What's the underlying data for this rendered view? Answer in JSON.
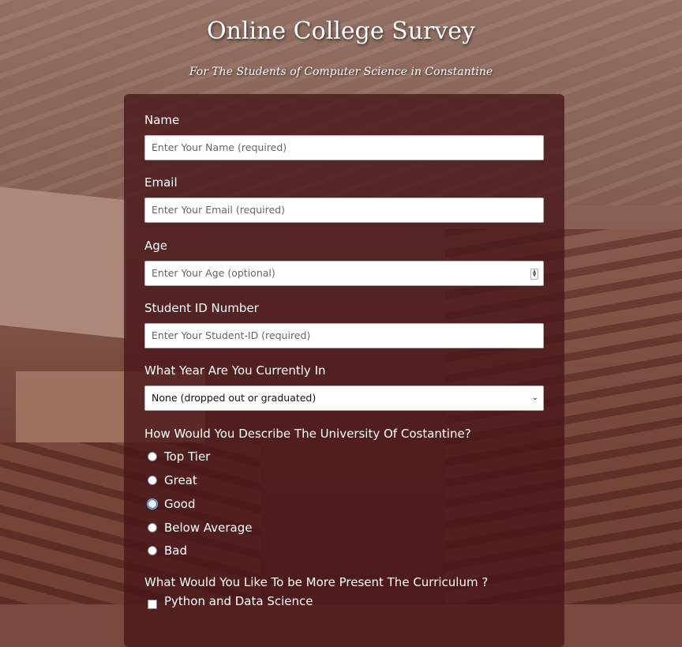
{
  "header": {
    "title": "Online College Survey",
    "subtitle": "For The Students of Computer Science in Constantine"
  },
  "form": {
    "name": {
      "label": "Name",
      "placeholder": "Enter Your Name (required)"
    },
    "email": {
      "label": "Email",
      "placeholder": "Enter Your Email (required)"
    },
    "age": {
      "label": "Age",
      "placeholder": "Enter Your Age (optional)"
    },
    "student_id": {
      "label": "Student ID Number",
      "placeholder": "Enter Your Student-ID (required)"
    },
    "year": {
      "label": "What Year Are You Currently In",
      "selected": "None (dropped out or graduated)"
    },
    "rating": {
      "question": "How Would You Describe The University Of Costantine?",
      "options": [
        "Top Tier",
        "Great",
        "Good",
        "Below Average",
        "Bad"
      ],
      "focused": "Good"
    },
    "curriculum": {
      "question": "What Would You Like To be More Present The Curriculum ?",
      "options": [
        "Python and Data Science"
      ]
    }
  }
}
